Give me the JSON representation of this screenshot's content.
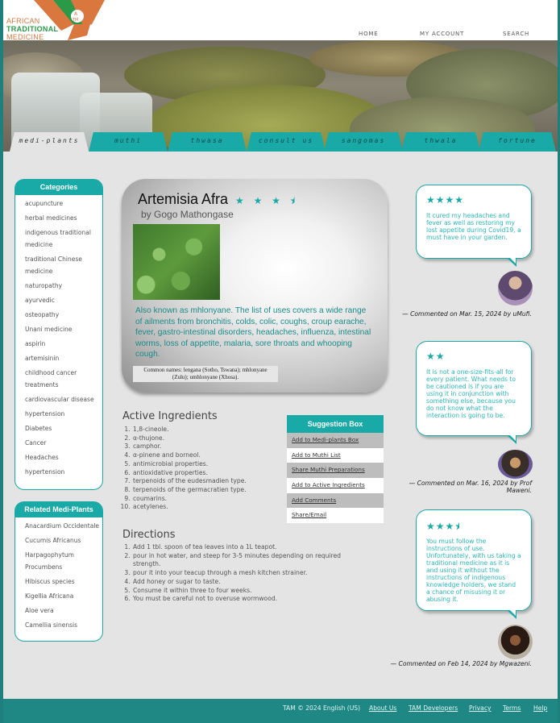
{
  "logo": {
    "line1": "AFRICAN",
    "line2": "TRADITIONAL",
    "line3": "MEDICINE",
    "mark": "TAM"
  },
  "top_nav": [
    "HOME",
    "MY ACCOUNT",
    "SEARCH"
  ],
  "tabs": [
    "medi-plants",
    "muthi",
    "thwasa",
    "consult us",
    "sangomas",
    "thwala",
    "fortune tellers"
  ],
  "categories": {
    "title": "Categories",
    "items": [
      "acupuncture",
      "herbal medicines",
      "indigenous traditional medicine",
      "traditional Chinese medicine",
      "naturopathy",
      "ayurvedic",
      "osteopathy",
      "Unani medicine",
      "aspirin",
      "artemisinin",
      "childhood cancer treatments",
      "cardiovascular disease",
      "hypertension",
      "Diabetes",
      "Cancer",
      "Headaches",
      "hypertension"
    ]
  },
  "related": {
    "title": "Related Medi-Plants",
    "items": [
      "Anacardium Occidentale",
      "Cucumis Africanus",
      "Harpagophytum Procumbens",
      "Hibiscus species",
      "Kigellia Africana",
      "Aloe vera",
      "Camellia sinensis"
    ]
  },
  "plant": {
    "name": "Artemisia Afra",
    "rating_stars": "★ ★ ★ ⯨",
    "rating": 3.5,
    "author": "by Gogo Mathongase",
    "description": "Also known as mhlonyane. The list of uses covers a wide range of ailments from bronchitis, colds, colic, coughs, croup earache, fever, gastro-intestinal disorders, headaches, influenza, intestinal worms, loss of appetite, malaria, sore throats and whooping cough.",
    "common_names": "Common names: lengana (Sotho, Tswana); mhlonyane (Zulu); umhlonyane (Xhosa)."
  },
  "ingredients": {
    "title": "Active Ingredients",
    "items": [
      "1,8-cineole.",
      "α-thujone.",
      "camphor.",
      "α-pinene and borneol.",
      "antimicrobial properties.",
      "antioxidative properties.",
      "terpenoids of the eudesmadien type.",
      "terpenoids of the germacratien type.",
      "coumarins.",
      "acetylenes."
    ]
  },
  "directions": {
    "title": "Directions",
    "items": [
      "Add 1 tbl. spoon of tea leaves into a 1L teapot.",
      "pour in hot water, and steep for 3-5 minutes depending on required strength.",
      "pour it into your teacup through a mesh kitchen strainer.",
      "Add honey or sugar to taste.",
      "Consume it within three to four weeks.",
      "You must be careful not to overuse wormwood."
    ]
  },
  "suggestion_box": {
    "title": "Suggestion Box",
    "items": [
      "Add to Medi-plants Box",
      "Add to Muthi List",
      "Share Muthi Preparations",
      "Add to Active Ingredients",
      "Add Comments",
      "Share/Email"
    ]
  },
  "comments": [
    {
      "stars": "★★★★",
      "rating": 4,
      "text": "It cured my headaches and fever as well as restoring my lost appetite during Covid19, a must have in your garden.",
      "meta": "— Commented on Mar. 15, 2024 by uMufi."
    },
    {
      "stars": "★★",
      "rating": 2,
      "text": "It is not a one-size-fits-all for every patient. What needs to be cautioned is if you are using it in conjunction with something else, because you do not know what the interaction is going to be.",
      "meta": "— Commented on Mar. 16, 2024 by Prof Maweni."
    },
    {
      "stars": "★★★⯨",
      "rating": 3.5,
      "text": "You must follow the instructions of use. Unfortunately, with us taking a traditional medicine as it is and using it without the instructions of indigenous knowledge holders, we stand a chance of misusing it or abusing it.",
      "meta": "— Commented on Feb 14, 2024 by Mgwazeni."
    }
  ],
  "footer": {
    "copyright": "TAM © 2024 English (US)",
    "links": [
      "About Us",
      "TAM Developers",
      "Privacy",
      "Terms",
      "Help"
    ]
  },
  "colors": {
    "accent": "#19a9a6",
    "footer": "#1f8784",
    "text_teal": "#1b8c89"
  }
}
